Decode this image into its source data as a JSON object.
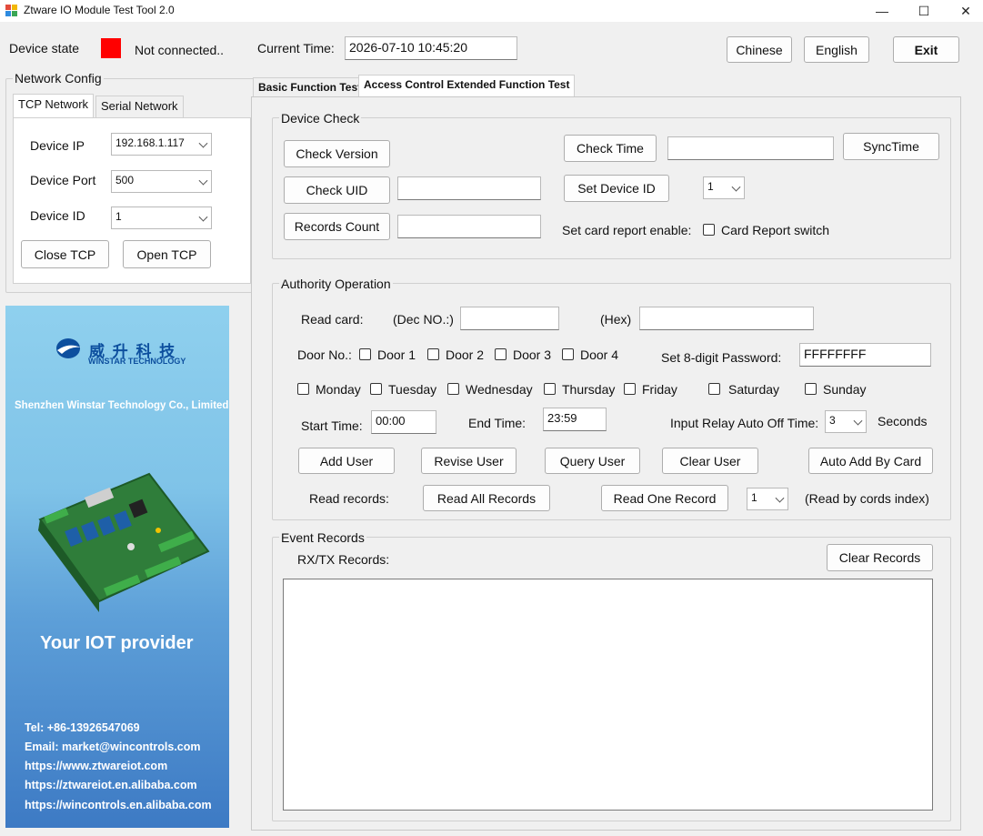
{
  "window": {
    "title": "Ztware IO Module Test Tool 2.0",
    "controls": {
      "minimize": "—",
      "maximize": "☐",
      "close": "✕"
    }
  },
  "status": {
    "device_state_label": "Device state",
    "indicator_color": "#ff0000",
    "connection_text": "Not connected..",
    "current_time_label": "Current Time:",
    "current_time_value": "2026-07-10 10:45:20"
  },
  "top_buttons": {
    "chinese": "Chinese",
    "english": "English",
    "exit": "Exit"
  },
  "network_config": {
    "title": "Network Config",
    "tabs": [
      {
        "label": "TCP Network",
        "active": true
      },
      {
        "label": "Serial Network",
        "active": false
      }
    ],
    "device_ip_label": "Device IP",
    "device_ip_value": "192.168.1.117",
    "device_port_label": "Device Port",
    "device_port_value": "500",
    "device_id_label": "Device ID",
    "device_id_value": "1",
    "close_tcp": "Close TCP",
    "open_tcp": "Open TCP"
  },
  "banner": {
    "brand_cn": "威 升 科 技",
    "brand_en": "WINSTAR TECHNOLOGY",
    "company": "Shenzhen Winstar Technology Co., Limited",
    "slogan": "Your IOT provider",
    "contacts": [
      "Tel: +86-13926547069",
      "Email: market@wincontrols.com",
      "https://www.ztwareiot.com",
      "https://ztwareiot.en.alibaba.com",
      "https://wincontrols.en.alibaba.com"
    ]
  },
  "main_tabs": [
    {
      "label": "Basic Function Test",
      "active": false
    },
    {
      "label": "Access Control Extended Function Test",
      "active": true
    }
  ],
  "device_check": {
    "title": "Device Check",
    "check_version": "Check Version",
    "check_time": "Check Time",
    "check_time_value": "",
    "sync_time": "SyncTime",
    "check_uid": "Check UID",
    "check_uid_value": "",
    "set_device_id": "Set Device ID",
    "set_device_id_value": "1",
    "records_count": "Records Count",
    "records_count_value": "",
    "card_report_label": "Set card report enable:",
    "card_report_checkbox": "Card Report switch"
  },
  "authority": {
    "title": "Authority Operation",
    "read_card_label": "Read card:",
    "dec_label": "(Dec NO.:)",
    "dec_value": "",
    "hex_label": "(Hex)",
    "hex_value": "",
    "door_label": "Door No.:",
    "doors": [
      "Door 1",
      "Door 2",
      "Door 3",
      "Door 4"
    ],
    "password_label": "Set 8-digit Password:",
    "password_value": "FFFFFFFF",
    "days": [
      "Monday",
      "Tuesday",
      "Wednesday",
      "Thursday",
      "Friday",
      "Saturday",
      "Sunday"
    ],
    "start_time_label": "Start Time:",
    "start_time_value": "00:00",
    "end_time_label": "End Time:",
    "end_time_value": "23:59",
    "relay_label": "Input Relay Auto Off Time:",
    "relay_value": "3",
    "relay_unit": "Seconds",
    "buttons": {
      "add_user": "Add User",
      "revise_user": "Revise User",
      "query_user": "Query User",
      "clear_user": "Clear User",
      "auto_add": "Auto Add By Card"
    },
    "read_records_label": "Read records:",
    "read_all": "Read All Records",
    "read_one": "Read One Record",
    "record_index_value": "1",
    "read_by_index_note": "(Read by cords index)"
  },
  "event_records": {
    "title": "Event Records",
    "rx_tx_label": "RX/TX Records:",
    "clear_records": "Clear Records",
    "log_text": ""
  }
}
